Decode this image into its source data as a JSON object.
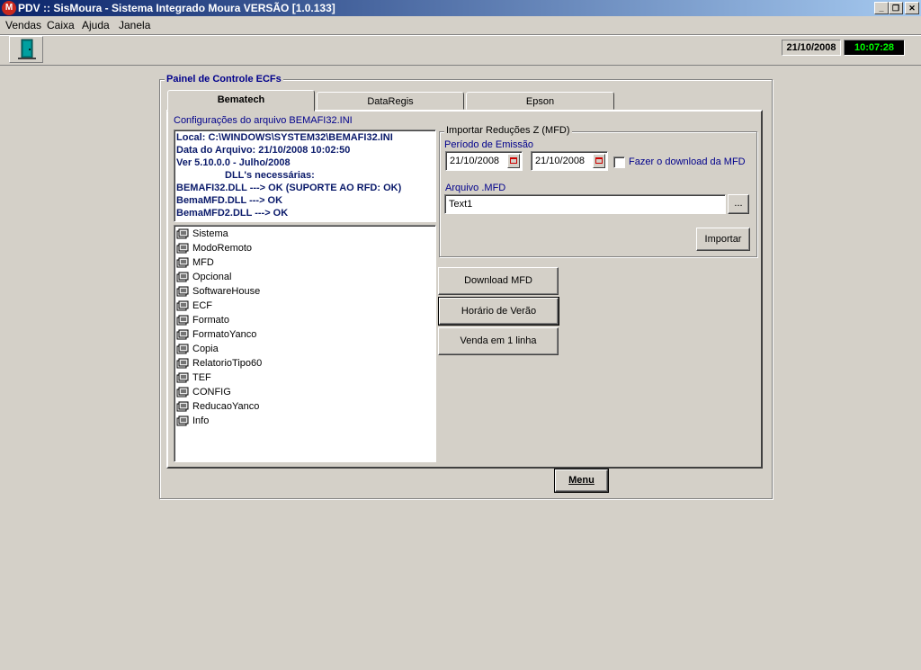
{
  "window": {
    "title": "PDV :: SisMoura - Sistema Integrado Moura   VERSÃO [1.0.133]",
    "app_icon": "M",
    "controls": {
      "minimize": "_",
      "restore": "❐",
      "close": "✕"
    }
  },
  "menu": [
    {
      "label": "Vendas"
    },
    {
      "label": "Caixa"
    },
    {
      "label": "Ajuda"
    },
    {
      "label": "Janela"
    }
  ],
  "status": {
    "date": "21/10/2008",
    "time": "10:07:28"
  },
  "panel": {
    "title": "Painel de Controle ECFs",
    "tabs": [
      {
        "label": "Bematech",
        "active": true
      },
      {
        "label": "DataRegis",
        "active": false
      },
      {
        "label": "Epson",
        "active": false
      }
    ],
    "config_label": "Configurações do arquivo BEMAFI32.INI",
    "info_lines": [
      "Local: C:\\WINDOWS\\SYSTEM32\\BEMAFI32.INI",
      "Data do Arquivo: 21/10/2008 10:02:50",
      "Ver 5.10.0.0 - Julho/2008",
      "DLL's necessárias:",
      "BEMAFI32.DLL ---> OK (SUPORTE AO RFD: OK)",
      "BemaMFD.DLL ---> OK",
      "BemaMFD2.DLL ---> OK"
    ],
    "tree_items": [
      "Sistema",
      "ModoRemoto",
      "MFD",
      "Opcional",
      "SoftwareHouse",
      "ECF",
      "Formato",
      "FormatoYanco",
      "Copia",
      "RelatorioTipo60",
      "TEF",
      "CONFIG",
      "ReducaoYanco",
      "Info"
    ],
    "import": {
      "group_title": "Importar Reduções Z (MFD)",
      "period_label": "Período de Emissão",
      "date_from": "21/10/2008",
      "date_to": "21/10/2008",
      "download_checkbox_label": "Fazer o download da MFD",
      "download_checked": false,
      "file_label": "Arquivo .MFD",
      "file_value": "Text1",
      "browse_label": "...",
      "import_button": "Importar"
    },
    "buttons": {
      "download_mfd": "Download MFD",
      "horario_verao": "Horário de Verão",
      "venda_1_linha": "Venda em 1 linha"
    },
    "menu_button": "Menu"
  }
}
